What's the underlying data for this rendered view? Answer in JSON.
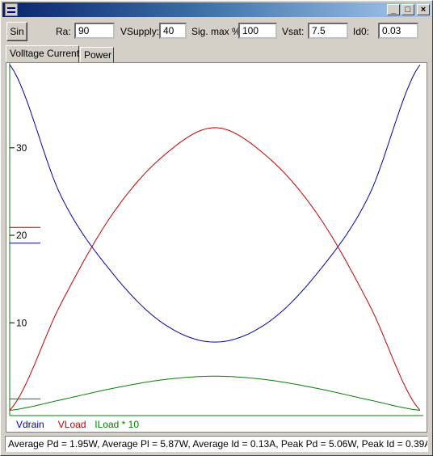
{
  "window": {
    "minimize_label": "_",
    "maximize_label": "□",
    "close_label": "×"
  },
  "toolbar": {
    "sin_label": "Sin",
    "ra_label": "Ra:",
    "ra_value": "90",
    "vsupply_label": "VSupply:",
    "vsupply_value": "40",
    "sig_label": "Sig. max %:",
    "sig_value": "100",
    "vsat_label": "Vsat:",
    "vsat_value": "7.5",
    "id0_label": "Id0:",
    "id0_value": "0.03"
  },
  "tabs": [
    {
      "label": "Volltage  Current"
    },
    {
      "label": "Power"
    }
  ],
  "status_text": "Average Pd = 1.95W, Average Pl = 5.87W,  Average Id = 0.13A, Peak Pd = 5.06W, Peak Id = 0.39A",
  "chart_data": {
    "type": "line",
    "ylim": [
      -0.6,
      39.5
    ],
    "y_ticks": [
      10,
      20,
      30
    ],
    "x": [
      0,
      0.125,
      0.25,
      0.375,
      0.5,
      0.625,
      0.75,
      0.875,
      1
    ],
    "series": [
      {
        "name": "Vdrain",
        "color": "#0000a0",
        "values": [
          39.5,
          24.5,
          15.7,
          9.9,
          7.8,
          9.9,
          15.7,
          24.5,
          39.5
        ]
      },
      {
        "name": "VLoad",
        "color": "#c00000",
        "values": [
          0,
          12.2,
          22.4,
          29.1,
          32.3,
          29.1,
          22.4,
          12.2,
          0
        ]
      },
      {
        "name": "ILoad * 10",
        "color": "#008000",
        "values": [
          0,
          1.2,
          2.5,
          3.5,
          3.9,
          3.5,
          2.5,
          1.2,
          0
        ]
      }
    ],
    "avg_markers": [
      {
        "series": "VLoad",
        "value": 20.9,
        "color": "#c00000"
      },
      {
        "series": "Vdrain",
        "value": 19.1,
        "color": "#0000a0"
      },
      {
        "series": "ILoad * 10",
        "value": 1.3,
        "color": "#008000"
      }
    ],
    "legend_placement": "bottom-left"
  }
}
